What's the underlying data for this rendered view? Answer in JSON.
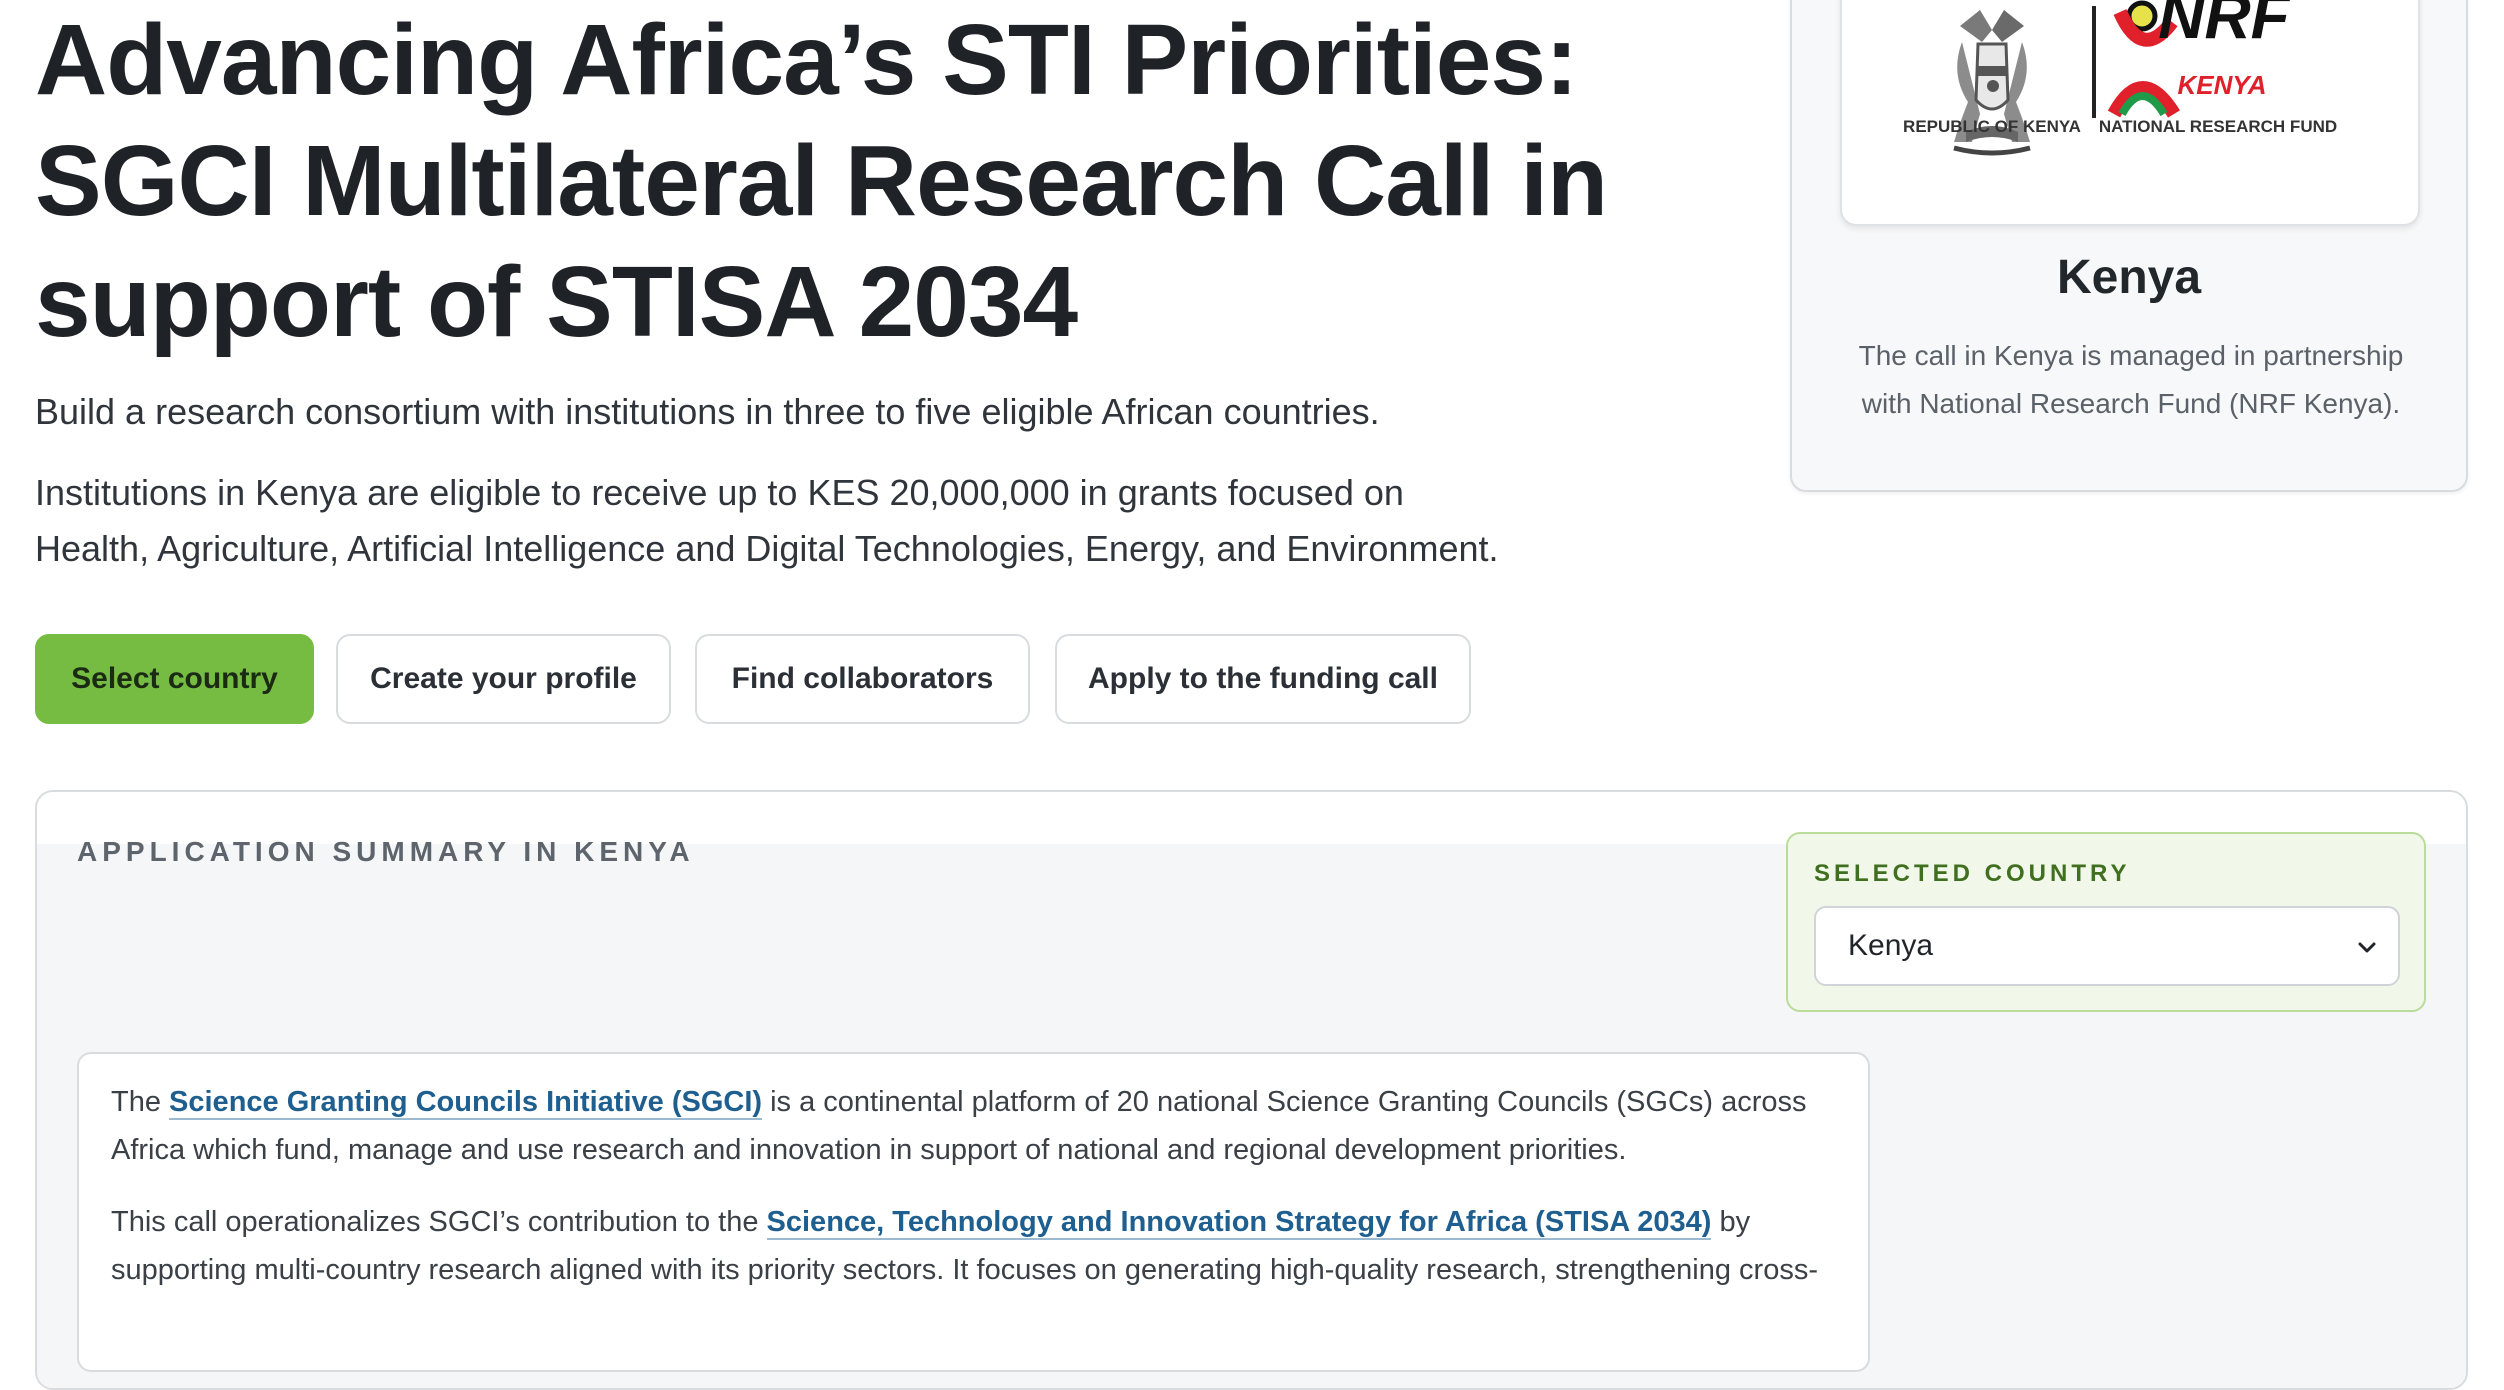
{
  "hero": {
    "title_line1": "Advancing Africa’s STI Priorities:",
    "title_line2": "SGCI Multilateral Research Call in",
    "title_line3": "support of STISA 2034",
    "lede": "Build a research consortium with institutions in three to five eligible African countries.",
    "eligibility_line1": "Institutions in Kenya are eligible to receive up to KES 20,000,000 in grants focused on",
    "eligibility_line2": "Health, Agriculture, Artificial Intelligence and Digital Technologies, Energy, and Environment."
  },
  "actions": {
    "select_country": "Select country",
    "create_profile": "Create your profile",
    "find_collaborators": "Find collaborators",
    "apply": "Apply to the funding call"
  },
  "partner": {
    "logo_left_caption": "REPUBLIC OF KENYA",
    "logo_right_name": "NRF",
    "logo_right_country": "KENYA",
    "logo_right_caption": "NATIONAL RESEARCH FUND",
    "country": "Kenya",
    "description": "The call in Kenya is managed in partnership with National Research Fund (NRF Kenya)."
  },
  "summary": {
    "heading": "Application summary in Kenya",
    "selected_country_label": "Selected country",
    "selected_country_value": "Kenya",
    "p1_before": "The ",
    "p1_link": "Science Granting Councils Initiative (SGCI)",
    "p1_after": " is a continental platform of 20 national Science Granting Councils (SGCs) across Africa which fund, manage and use research and innovation in support of national and regional development priorities.",
    "p2_before": "This call operationalizes SGCI’s contribution to the ",
    "p2_link": "Science, Technology and Innovation Strategy for Africa (STISA 2034)",
    "p2_after": " by supporting multi-country research aligned with its priority sectors. It focuses on generating high-quality research, strengthening cross-"
  },
  "colors": {
    "primary_green": "#76bc43",
    "link_blue": "#1f5f8f",
    "nrf_red": "#e0202a",
    "nrf_green": "#1e9a48"
  }
}
